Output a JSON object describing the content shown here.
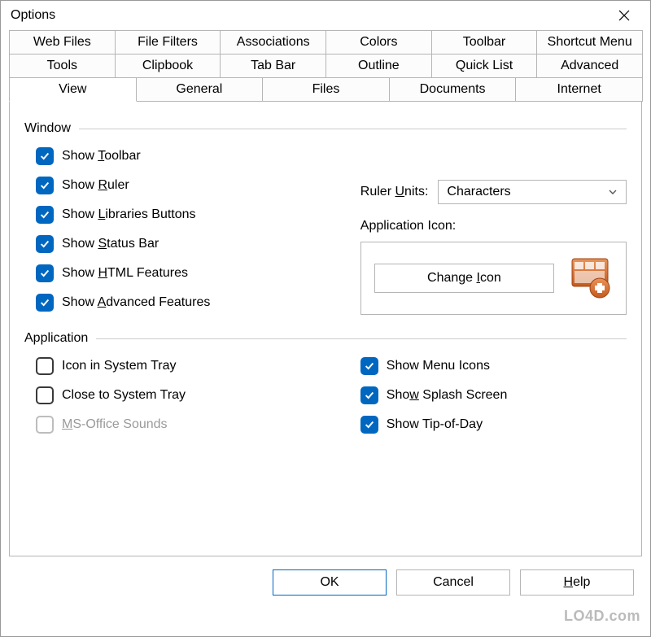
{
  "window": {
    "title": "Options"
  },
  "tabs": {
    "row1": [
      "Web Files",
      "File Filters",
      "Associations",
      "Colors",
      "Toolbar",
      "Shortcut Menu"
    ],
    "row2": [
      "Tools",
      "Clipbook",
      "Tab Bar",
      "Outline",
      "Quick List",
      "Advanced"
    ],
    "row3": [
      "View",
      "General",
      "Files",
      "Documents",
      "Internet"
    ],
    "active": "View"
  },
  "sections": {
    "window": {
      "label": "Window",
      "checkboxes": [
        {
          "label_pre": "Show ",
          "u": "T",
          "label_post": "oolbar",
          "checked": true
        },
        {
          "label_pre": "Show ",
          "u": "R",
          "label_post": "uler",
          "checked": true
        },
        {
          "label_pre": "Show ",
          "u": "L",
          "label_post": "ibraries Buttons",
          "checked": true
        },
        {
          "label_pre": "Show ",
          "u": "S",
          "label_post": "tatus Bar",
          "checked": true
        },
        {
          "label_pre": "Show ",
          "u": "H",
          "label_post": "TML Features",
          "checked": true
        },
        {
          "label_pre": "Show ",
          "u": "A",
          "label_post": "dvanced Features",
          "checked": true
        }
      ],
      "ruler_units_label_pre": "Ruler ",
      "ruler_units_label_u": "U",
      "ruler_units_label_post": "nits:",
      "ruler_units_value": "Characters",
      "app_icon_label": "Application Icon:",
      "change_icon_pre": "Change ",
      "change_icon_u": "I",
      "change_icon_post": "con"
    },
    "application": {
      "label": "Application",
      "left_checkboxes": [
        {
          "label_pre": "Icon in System Tray",
          "u": "",
          "label_post": "",
          "checked": false,
          "disabled": false
        },
        {
          "label_pre": "Close to System Tray",
          "u": "",
          "label_post": "",
          "checked": false,
          "disabled": false
        },
        {
          "label_pre": "",
          "u": "M",
          "label_post": "S-Office Sounds",
          "checked": false,
          "disabled": true
        }
      ],
      "right_checkboxes": [
        {
          "label_pre": "Show Menu Icons",
          "u": "",
          "label_post": "",
          "checked": true
        },
        {
          "label_pre": "Sho",
          "u": "w",
          "label_post": " Splash Screen",
          "checked": true
        },
        {
          "label_pre": "Show Tip-of-Day",
          "u": "",
          "label_post": "",
          "checked": true
        }
      ]
    }
  },
  "buttons": {
    "ok": "OK",
    "cancel": "Cancel",
    "help_u": "H",
    "help_post": "elp"
  },
  "watermark": "LO4D.com"
}
